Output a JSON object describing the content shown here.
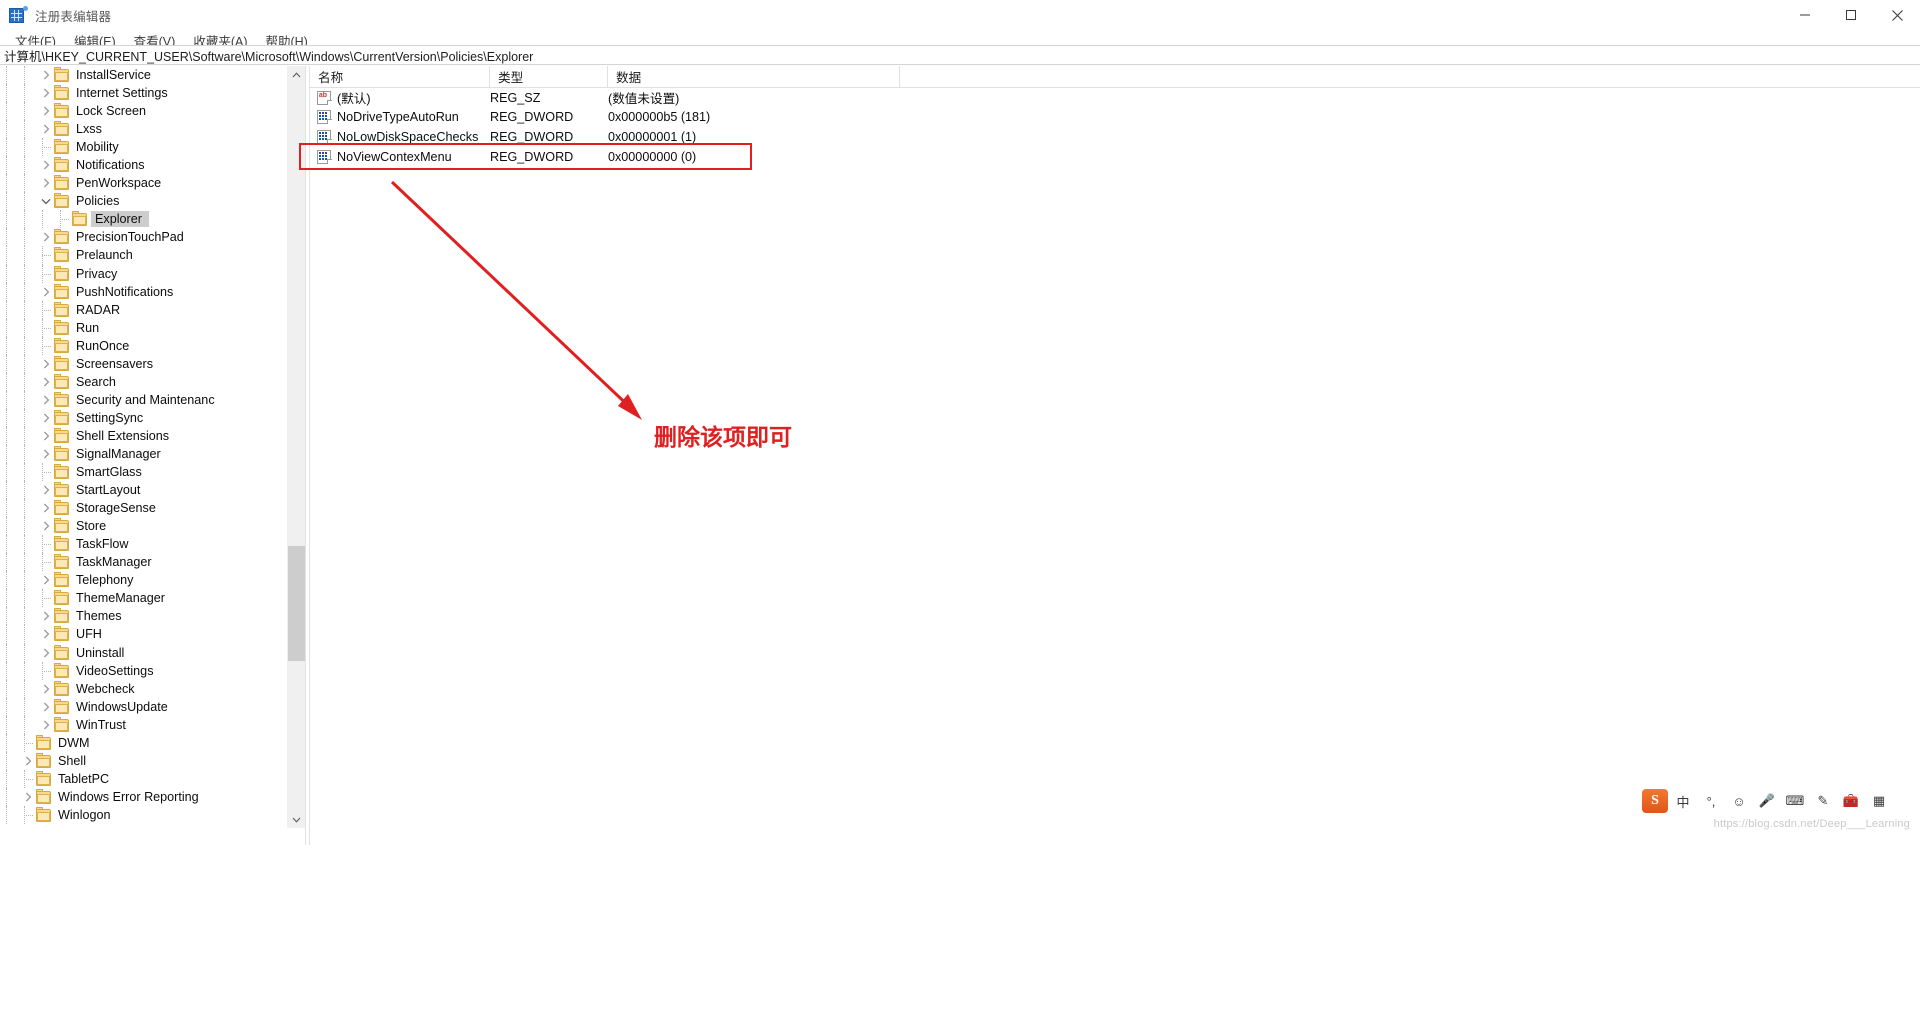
{
  "window": {
    "title": "注册表编辑器",
    "icon": "registry-editor-icon",
    "controls": {
      "minimize": "minimize-icon",
      "maximize": "maximize-icon",
      "close": "close-icon"
    }
  },
  "menubar": {
    "items": [
      {
        "label": "文件(F)"
      },
      {
        "label": "编辑(E)"
      },
      {
        "label": "查看(V)"
      },
      {
        "label": "收藏夹(A)"
      },
      {
        "label": "帮助(H)"
      }
    ]
  },
  "address": {
    "path": "计算机\\HKEY_CURRENT_USER\\Software\\Microsoft\\Windows\\CurrentVersion\\Policies\\Explorer"
  },
  "tree": {
    "items": [
      {
        "label": "InstallService",
        "indent": 2,
        "expander": "right",
        "selected": false
      },
      {
        "label": "Internet Settings",
        "indent": 2,
        "expander": "right",
        "selected": false
      },
      {
        "label": "Lock Screen",
        "indent": 2,
        "expander": "right",
        "selected": false
      },
      {
        "label": "Lxss",
        "indent": 2,
        "expander": "right",
        "selected": false
      },
      {
        "label": "Mobility",
        "indent": 2,
        "expander": "none",
        "selected": false
      },
      {
        "label": "Notifications",
        "indent": 2,
        "expander": "right",
        "selected": false
      },
      {
        "label": "PenWorkspace",
        "indent": 2,
        "expander": "right",
        "selected": false
      },
      {
        "label": "Policies",
        "indent": 2,
        "expander": "down",
        "selected": false
      },
      {
        "label": "Explorer",
        "indent": 3,
        "expander": "none",
        "selected": true
      },
      {
        "label": "PrecisionTouchPad",
        "indent": 2,
        "expander": "right",
        "selected": false
      },
      {
        "label": "Prelaunch",
        "indent": 2,
        "expander": "none",
        "selected": false
      },
      {
        "label": "Privacy",
        "indent": 2,
        "expander": "none",
        "selected": false
      },
      {
        "label": "PushNotifications",
        "indent": 2,
        "expander": "right",
        "selected": false
      },
      {
        "label": "RADAR",
        "indent": 2,
        "expander": "none",
        "selected": false
      },
      {
        "label": "Run",
        "indent": 2,
        "expander": "none",
        "selected": false
      },
      {
        "label": "RunOnce",
        "indent": 2,
        "expander": "none",
        "selected": false
      },
      {
        "label": "Screensavers",
        "indent": 2,
        "expander": "right",
        "selected": false
      },
      {
        "label": "Search",
        "indent": 2,
        "expander": "right",
        "selected": false
      },
      {
        "label": "Security and Maintenanc",
        "indent": 2,
        "expander": "right",
        "selected": false
      },
      {
        "label": "SettingSync",
        "indent": 2,
        "expander": "right",
        "selected": false
      },
      {
        "label": "Shell Extensions",
        "indent": 2,
        "expander": "right",
        "selected": false
      },
      {
        "label": "SignalManager",
        "indent": 2,
        "expander": "right",
        "selected": false
      },
      {
        "label": "SmartGlass",
        "indent": 2,
        "expander": "none",
        "selected": false
      },
      {
        "label": "StartLayout",
        "indent": 2,
        "expander": "right",
        "selected": false
      },
      {
        "label": "StorageSense",
        "indent": 2,
        "expander": "right",
        "selected": false
      },
      {
        "label": "Store",
        "indent": 2,
        "expander": "right",
        "selected": false
      },
      {
        "label": "TaskFlow",
        "indent": 2,
        "expander": "none",
        "selected": false
      },
      {
        "label": "TaskManager",
        "indent": 2,
        "expander": "none",
        "selected": false
      },
      {
        "label": "Telephony",
        "indent": 2,
        "expander": "right",
        "selected": false
      },
      {
        "label": "ThemeManager",
        "indent": 2,
        "expander": "none",
        "selected": false
      },
      {
        "label": "Themes",
        "indent": 2,
        "expander": "right",
        "selected": false
      },
      {
        "label": "UFH",
        "indent": 2,
        "expander": "right",
        "selected": false
      },
      {
        "label": "Uninstall",
        "indent": 2,
        "expander": "right",
        "selected": false
      },
      {
        "label": "VideoSettings",
        "indent": 2,
        "expander": "none",
        "selected": false
      },
      {
        "label": "Webcheck",
        "indent": 2,
        "expander": "right",
        "selected": false
      },
      {
        "label": "WindowsUpdate",
        "indent": 2,
        "expander": "right",
        "selected": false
      },
      {
        "label": "WinTrust",
        "indent": 2,
        "expander": "right",
        "selected": false
      },
      {
        "label": "DWM",
        "indent": 1,
        "expander": "none",
        "selected": false
      },
      {
        "label": "Shell",
        "indent": 1,
        "expander": "right",
        "selected": false
      },
      {
        "label": "TabletPC",
        "indent": 1,
        "expander": "none",
        "selected": false
      },
      {
        "label": "Windows Error Reporting",
        "indent": 1,
        "expander": "right",
        "selected": false
      },
      {
        "label": "Winlogon",
        "indent": 1,
        "expander": "none",
        "selected": false
      }
    ]
  },
  "list": {
    "columns": [
      {
        "label": "名称"
      },
      {
        "label": "类型"
      },
      {
        "label": "数据"
      },
      {
        "label": ""
      }
    ],
    "rows": [
      {
        "icon": "string-value-icon",
        "name": "(默认)",
        "type": "REG_SZ",
        "data": "(数值未设置)",
        "highlighted": false
      },
      {
        "icon": "dword-value-icon",
        "name": "NoDriveTypeAutoRun",
        "type": "REG_DWORD",
        "data": "0x000000b5 (181)",
        "highlighted": false
      },
      {
        "icon": "dword-value-icon",
        "name": "NoLowDiskSpaceChecks",
        "type": "REG_DWORD",
        "data": "0x00000001 (1)",
        "highlighted": false
      },
      {
        "icon": "dword-value-icon",
        "name": "NoViewContexMenu",
        "type": "REG_DWORD",
        "data": "0x00000000 (0)",
        "highlighted": true
      }
    ]
  },
  "annotation": {
    "text": "删除该项即可",
    "color": "#e02020",
    "box_color": "#e02020"
  },
  "ime": {
    "logo": "S",
    "buttons": [
      {
        "icon": "chinese-mode-icon",
        "label": "中"
      },
      {
        "icon": "punctuation-icon",
        "label": "°,"
      },
      {
        "icon": "emoji-icon",
        "label": "☺"
      },
      {
        "icon": "microphone-icon",
        "label": "🎤"
      },
      {
        "icon": "keyboard-icon",
        "label": "⌨"
      },
      {
        "icon": "handwriting-icon",
        "label": "✎"
      },
      {
        "icon": "toolbox-icon",
        "label": "🧰"
      },
      {
        "icon": "panel-icon",
        "label": "▦"
      }
    ]
  },
  "watermark": {
    "text": "https://blog.csdn.net/Deep___Learning"
  }
}
